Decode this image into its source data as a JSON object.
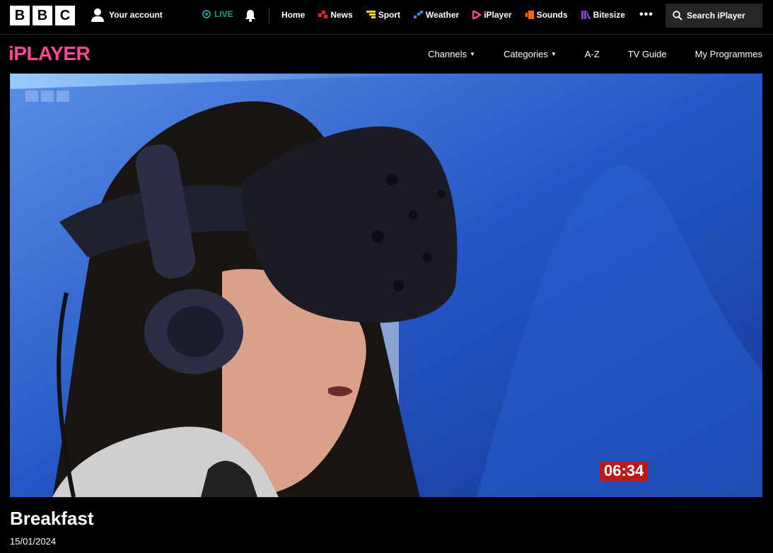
{
  "header": {
    "logo_letters": [
      "B",
      "B",
      "C"
    ],
    "account_label": "Your account",
    "live_label": "LIVE",
    "nav": [
      {
        "label": "Home",
        "icon": "home",
        "color": ""
      },
      {
        "label": "News",
        "icon": "news-icon",
        "color": "#e61f26"
      },
      {
        "label": "Sport",
        "icon": "sport-icon",
        "color": "#ffd230"
      },
      {
        "label": "Weather",
        "icon": "weather-icon",
        "color": "#2d8de0"
      },
      {
        "label": "iPlayer",
        "icon": "iplayer-icon",
        "color": "#f54997"
      },
      {
        "label": "Sounds",
        "icon": "sounds-icon",
        "color": "#ff6600"
      },
      {
        "label": "Bitesize",
        "icon": "bitesize-icon",
        "color": "#8b3fd6"
      }
    ],
    "more_label": "•••",
    "search_label": "Search iPlayer"
  },
  "iplayer": {
    "logo": "iPLAYER",
    "nav": [
      {
        "label": "Channels",
        "dropdown": true
      },
      {
        "label": "Categories",
        "dropdown": true
      },
      {
        "label": "A-Z",
        "dropdown": false
      },
      {
        "label": "TV Guide",
        "dropdown": false
      },
      {
        "label": "My Programmes",
        "dropdown": false
      }
    ]
  },
  "player": {
    "timestamp": "06:34"
  },
  "programme": {
    "title": "Breakfast",
    "date": "15/01/2024"
  },
  "colors": {
    "accent": "#f54997",
    "live": "#1a9e8f",
    "timestamp_bg": "#bb1919"
  }
}
